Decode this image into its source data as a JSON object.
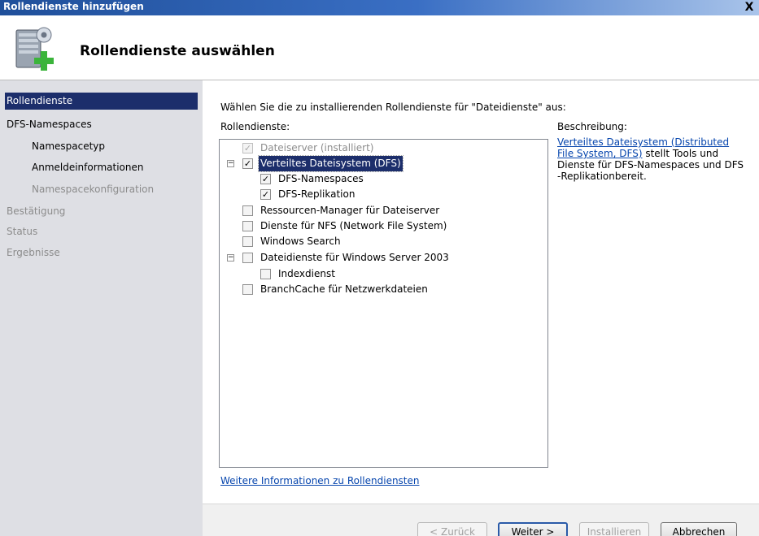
{
  "window": {
    "title": "Rollendienste hinzufügen",
    "close_glyph": "X"
  },
  "header": {
    "heading": "Rollendienste auswählen",
    "icon": "server-add-icon"
  },
  "nav": {
    "items": [
      {
        "label": "Rollendienste",
        "state": "active"
      },
      {
        "label": "DFS-Namespaces",
        "state": "normal"
      },
      {
        "label": "Namespacetyp",
        "state": "sub"
      },
      {
        "label": "Anmeldeinformationen",
        "state": "sub"
      },
      {
        "label": "Namespacekonfiguration",
        "state": "sub-disabled"
      },
      {
        "label": "Bestätigung",
        "state": "disabled"
      },
      {
        "label": "Status",
        "state": "disabled"
      },
      {
        "label": "Ergebnisse",
        "state": "disabled"
      }
    ]
  },
  "main": {
    "instruction": "Wählen Sie die zu installierenden Rollendienste für \"Dateidienste\" aus:",
    "services_label": "Rollendienste:",
    "tree": [
      {
        "label": "Dateiserver  (installiert)",
        "checked": true,
        "disabled": true,
        "level": 0,
        "expander": ""
      },
      {
        "label": "Verteiltes Dateisystem (DFS)",
        "checked": true,
        "selected": true,
        "level": 0,
        "expander": "−"
      },
      {
        "label": "DFS-Namespaces",
        "checked": true,
        "level": 1,
        "expander": ""
      },
      {
        "label": "DFS-Replikation",
        "checked": true,
        "level": 1,
        "expander": ""
      },
      {
        "label": "Ressourcen-Manager für Dateiserver",
        "checked": false,
        "level": 0,
        "expander": ""
      },
      {
        "label": "Dienste für NFS (Network File System)",
        "checked": false,
        "level": 0,
        "expander": ""
      },
      {
        "label": "Windows Search",
        "checked": false,
        "level": 0,
        "expander": ""
      },
      {
        "label": "Dateidienste für Windows Server 2003",
        "checked": false,
        "level": 0,
        "expander": "−"
      },
      {
        "label": "Indexdienst",
        "checked": false,
        "level": 1,
        "expander": ""
      },
      {
        "label": "BranchCache für Netzwerkdateien",
        "checked": false,
        "level": 0,
        "expander": ""
      }
    ],
    "description_label": "Beschreibung:",
    "description_link": "Verteiltes Dateisystem (Distributed File System, DFS)",
    "description_text": " stellt Tools und Dienste für DFS-Namespaces und DFS -Replikationbereit.",
    "more_info_link": "Weitere Informationen zu Rollendiensten"
  },
  "footer": {
    "back": "< Zurück",
    "next": "Weiter >",
    "install": "Installieren",
    "cancel": "Abbrechen"
  },
  "colors": {
    "selection": "#1c2e6b",
    "nav_bg": "#dedfe4",
    "link": "#0645ad"
  }
}
